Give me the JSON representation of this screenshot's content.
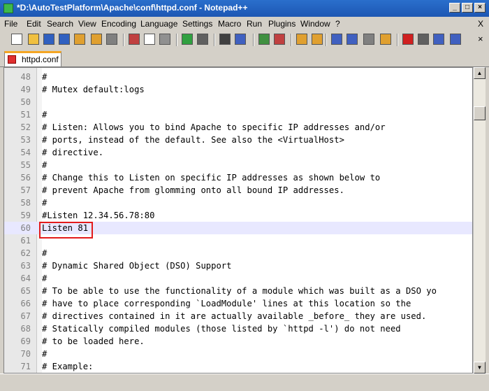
{
  "window": {
    "title": "*D:\\AutoTestPlatform\\Apache\\conf\\httpd.conf - Notepad++"
  },
  "menu": [
    "File",
    "Edit",
    "Search",
    "View",
    "Encoding",
    "Language",
    "Settings",
    "Macro",
    "Run",
    "Plugins",
    "Window",
    "?"
  ],
  "menu_close": "X",
  "tab": {
    "label": "httpd.conf"
  },
  "editor": {
    "current_line": 60,
    "lines": [
      {
        "n": "48",
        "text": "#"
      },
      {
        "n": "49",
        "text": "# Mutex default:logs"
      },
      {
        "n": "50",
        "text": ""
      },
      {
        "n": "51",
        "text": "#"
      },
      {
        "n": "52",
        "text": "# Listen: Allows you to bind Apache to specific IP addresses and/or"
      },
      {
        "n": "53",
        "text": "# ports, instead of the default. See also the <VirtualHost>"
      },
      {
        "n": "54",
        "text": "# directive."
      },
      {
        "n": "55",
        "text": "#"
      },
      {
        "n": "56",
        "text": "# Change this to Listen on specific IP addresses as shown below to"
      },
      {
        "n": "57",
        "text": "# prevent Apache from glomming onto all bound IP addresses."
      },
      {
        "n": "58",
        "text": "#"
      },
      {
        "n": "59",
        "text": "#Listen 12.34.56.78:80"
      },
      {
        "n": "60",
        "text": "Listen 81"
      },
      {
        "n": "61",
        "text": ""
      },
      {
        "n": "62",
        "text": "#"
      },
      {
        "n": "63",
        "text": "# Dynamic Shared Object (DSO) Support"
      },
      {
        "n": "64",
        "text": "#"
      },
      {
        "n": "65",
        "text": "# To be able to use the functionality of a module which was built as a DSO yo"
      },
      {
        "n": "66",
        "text": "# have to place corresponding `LoadModule' lines at this location so the"
      },
      {
        "n": "67",
        "text": "# directives contained in it are actually available _before_ they are used."
      },
      {
        "n": "68",
        "text": "# Statically compiled modules (those listed by `httpd -l') do not need"
      },
      {
        "n": "69",
        "text": "# to be loaded here."
      },
      {
        "n": "70",
        "text": "#"
      },
      {
        "n": "71",
        "text": "# Example:"
      }
    ]
  },
  "toolbar": {
    "icons": [
      "new-file-icon",
      "open-file-icon",
      "save-icon",
      "save-all-icon",
      "close-icon",
      "close-all-icon",
      "print-icon",
      "cut-icon",
      "copy-icon",
      "paste-icon",
      "undo-icon",
      "redo-icon",
      "find-icon",
      "replace-icon",
      "zoom-in-icon",
      "zoom-out-icon",
      "sync-vertical-icon",
      "sync-horizontal-icon",
      "word-wrap-icon",
      "show-all-chars-icon",
      "indent-guide-icon",
      "user-language-icon",
      "record-macro-icon",
      "stop-recording-icon",
      "playback-macro-icon",
      "run-macro-multiple-icon"
    ]
  },
  "colors": {
    "highlight_box": "#e31b1b",
    "current_line": "#e8e8ff",
    "title_bar": "#1d57b3"
  }
}
